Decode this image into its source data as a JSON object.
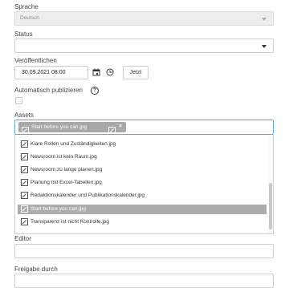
{
  "sprache": {
    "label": "Sprache",
    "value": "Deutsch"
  },
  "status": {
    "label": "Status",
    "value": ""
  },
  "veroeffentlichen": {
    "label": "Veröffentlichen",
    "date_value": "30.09.2021 08:00",
    "now_button": "Jetzt"
  },
  "auto_publish": {
    "label": "Automatisch publizieren",
    "checked": false
  },
  "assets": {
    "label": "Assets",
    "selected_tag": "Start before you can.jpg",
    "options": [
      "Klare Rollen und Zuständigkeiten.jpg",
      "Newsroom ist kein Raum.jpg",
      "Newsroom zu lange planen.jpg",
      "Planung mit Excel-Tabellen.jpg",
      "Redaktionskalender und Publikationskalender.jpg",
      "Start before you can.jpg",
      "Transparenz ist nicht Kontrolle.jpg"
    ],
    "highlighted_index": 5
  },
  "editor": {
    "label": "Editor"
  },
  "freigabe": {
    "label": "Freigabe durch"
  },
  "colors": {
    "focus_border": "#55a7e6",
    "tag_bg": "#a8a8a8",
    "selected_bg": "#ababab"
  }
}
